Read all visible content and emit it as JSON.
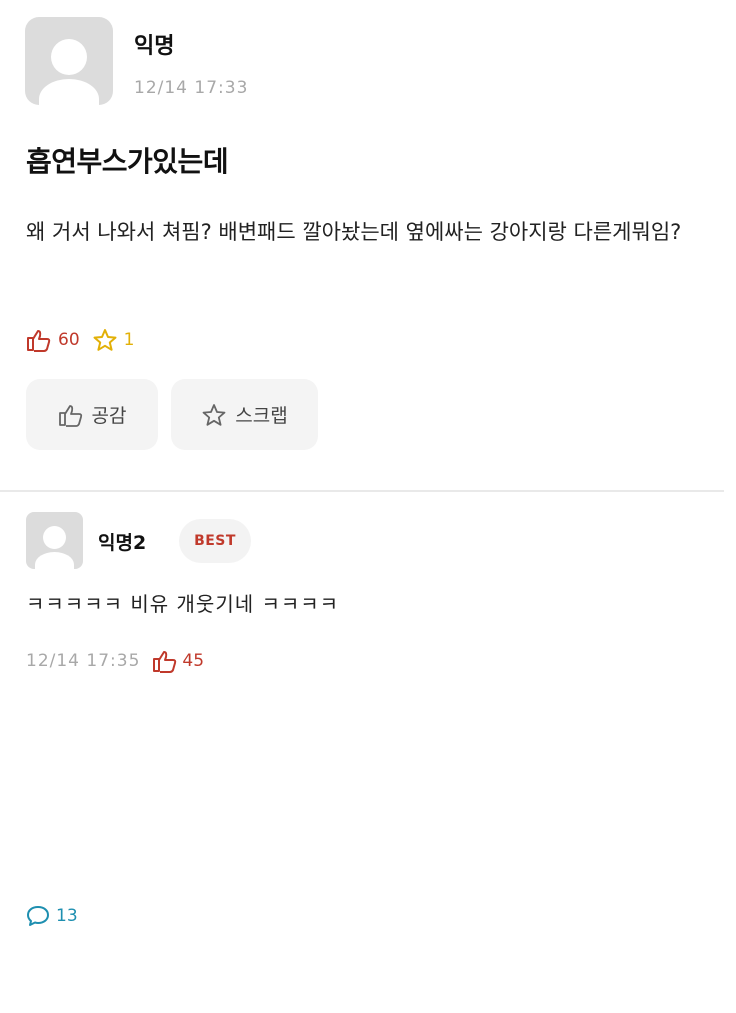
{
  "post": {
    "author": "익명",
    "timestamp": "12/14 17:33",
    "title": "흡연부스가있는데",
    "body": "왜 거서 나와서 쳐핌? 배변패드 깔아놨는데 옆에싸는 강아지랑 다른게뭐임?",
    "stats": {
      "likes": "60",
      "comments": "13",
      "scraps": "1"
    },
    "buttons": {
      "like_label": "공감",
      "scrap_label": "스크랩"
    }
  },
  "comment": {
    "author": "익명2",
    "badge": "BEST",
    "text": "ㅋㅋㅋㅋㅋ 비유 개웃기네 ㅋㅋㅋㅋ",
    "timestamp": "12/14 17:35",
    "likes": "45"
  },
  "colors": {
    "like": "#c0392b",
    "comment": "#1e8fb0",
    "scrap": "#e2b007"
  }
}
